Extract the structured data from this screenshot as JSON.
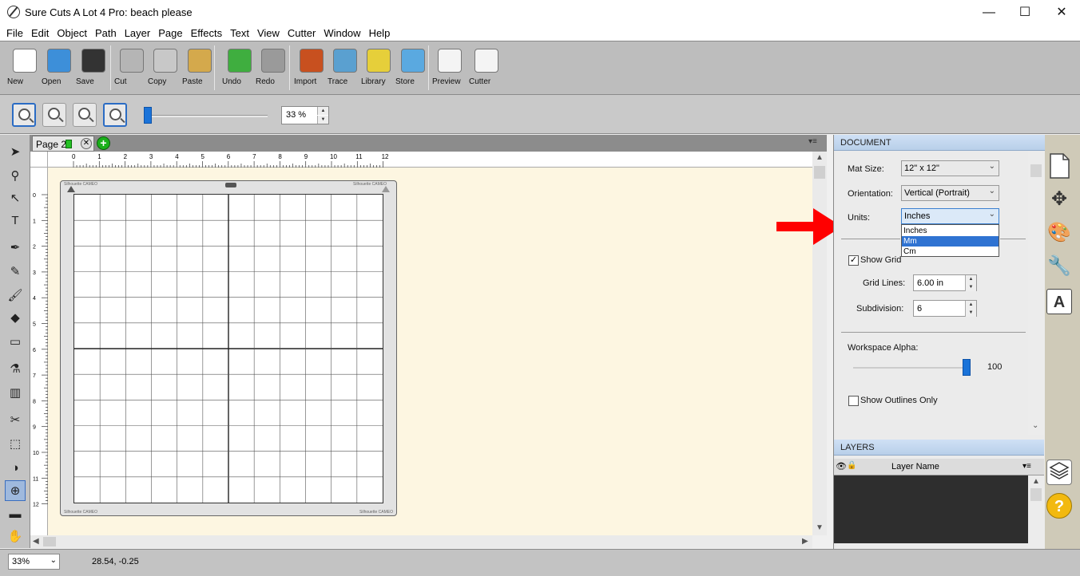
{
  "window": {
    "title": "Sure Cuts A Lot 4 Pro: beach please",
    "minimize_glyph": "—",
    "maximize_glyph": "☐",
    "close_glyph": "✕"
  },
  "menu": [
    "File",
    "Edit",
    "Object",
    "Path",
    "Layer",
    "Page",
    "Effects",
    "Text",
    "View",
    "Cutter",
    "Window",
    "Help"
  ],
  "toolbar": {
    "buttons": [
      {
        "label": "New",
        "icon": "new-document-icon",
        "color": "#ffffff"
      },
      {
        "label": "Open",
        "icon": "folder-open-icon",
        "color": "#3d8fd9"
      },
      {
        "label": "Save",
        "icon": "floppy-disk-icon",
        "color": "#333333"
      },
      {
        "label": "Cut",
        "icon": "scissors-icon",
        "color": "#b5b5b5"
      },
      {
        "label": "Copy",
        "icon": "copy-icon",
        "color": "#c8c8c8"
      },
      {
        "label": "Paste",
        "icon": "clipboard-icon",
        "color": "#d4a94c"
      },
      {
        "label": "Undo",
        "icon": "undo-icon",
        "color": "#3fae3f"
      },
      {
        "label": "Redo",
        "icon": "redo-icon",
        "color": "#9a9a9a"
      },
      {
        "label": "Import",
        "icon": "import-svg-icon",
        "color": "#c8501f"
      },
      {
        "label": "Trace",
        "icon": "trace-icon",
        "color": "#5aa0d0"
      },
      {
        "label": "Library",
        "icon": "library-star-icon",
        "color": "#e6cf3a"
      },
      {
        "label": "Store",
        "icon": "shopping-cart-icon",
        "color": "#5aa9e0"
      },
      {
        "label": "Preview",
        "icon": "preview-magnifier-icon",
        "color": "#f4f4f4"
      },
      {
        "label": "Cutter",
        "icon": "cutter-pen-icon",
        "color": "#f4f4f4"
      }
    ]
  },
  "zoom": {
    "value": "33 %",
    "spin_up": "▲",
    "spin_down": "▼"
  },
  "canvas": {
    "page_tab": "Page 2",
    "tab_close": "✕",
    "add_page": "+",
    "tab_menu": "▾≡",
    "ruler_h": [
      "0",
      "1",
      "2",
      "3",
      "4",
      "5",
      "6",
      "7",
      "8",
      "9",
      "10",
      "11",
      "12"
    ],
    "ruler_v": [
      "0",
      "1",
      "2",
      "3",
      "4",
      "5",
      "6",
      "7",
      "8",
      "9",
      "10",
      "11",
      "12"
    ],
    "mat_brand": "Silhouette CAMEO",
    "scroll_up": "▲",
    "scroll_down": "▼",
    "scroll_left": "◀",
    "scroll_right": "▶"
  },
  "document_panel": {
    "header": "DOCUMENT",
    "mat_size_label": "Mat Size:",
    "mat_size_value": "12\" x 12\"",
    "orientation_label": "Orientation:",
    "orientation_value": "Vertical (Portrait)",
    "units_label": "Units:",
    "units_value": "Inches",
    "units_options": [
      "Inches",
      "Mm",
      "Cm"
    ],
    "units_highlighted": "Mm",
    "show_grid_label": "Show Grid",
    "show_grid_check": "✓",
    "grid_lines_label": "Grid Lines:",
    "grid_lines_value": "6.00 in",
    "subdivision_label": "Subdivision:",
    "subdivision_value": "6",
    "workspace_alpha_label": "Workspace Alpha:",
    "workspace_alpha_value": "100",
    "show_outlines_label": "Show Outlines Only",
    "chevron": "⌄"
  },
  "layers_panel": {
    "header": "LAYERS",
    "column_name": "Layer Name",
    "visibility_glyph": "👁",
    "lock_glyph": "🔒",
    "menu_glyph": "▾≡"
  },
  "side_icons": [
    "document-page-icon",
    "move-arrows-icon",
    "palette-icon",
    "wrench-icon",
    "text-size-icon",
    "layers-stack-icon",
    "help-icon"
  ],
  "side_glyphs": {
    "move": "✥",
    "palette": "🎨",
    "wrench": "🔧",
    "text": "A",
    "help": "?"
  },
  "tools": [
    "select-arrow-icon",
    "node-edit-icon",
    "subselect-icon",
    "text-tool-icon",
    "pen-tool-icon",
    "pencil-icon",
    "brush-icon",
    "eraser-icon",
    "rectangle-tool-icon",
    "eyedropper-icon",
    "gradient-icon",
    "knife-icon",
    "transform-icon",
    "contrast-icon",
    "zoom-tool-icon",
    "ruler-tool-icon",
    "hand-pan-icon"
  ],
  "tool_glyphs": [
    "➤",
    "⚲",
    "↖",
    "T",
    "✒",
    "✎",
    "🖌",
    "◆",
    "▭",
    "⚗",
    "▥",
    "✂",
    "⬚",
    "◑",
    "⊕",
    "▬",
    "✋"
  ],
  "status": {
    "zoom": "33%",
    "coords": "28.54, -0.25"
  },
  "colors": {
    "accent": "#1a73d9",
    "mat_bg": "#fdf6e1",
    "arrow": "#ff0000",
    "add_page": "#1ab01a"
  }
}
